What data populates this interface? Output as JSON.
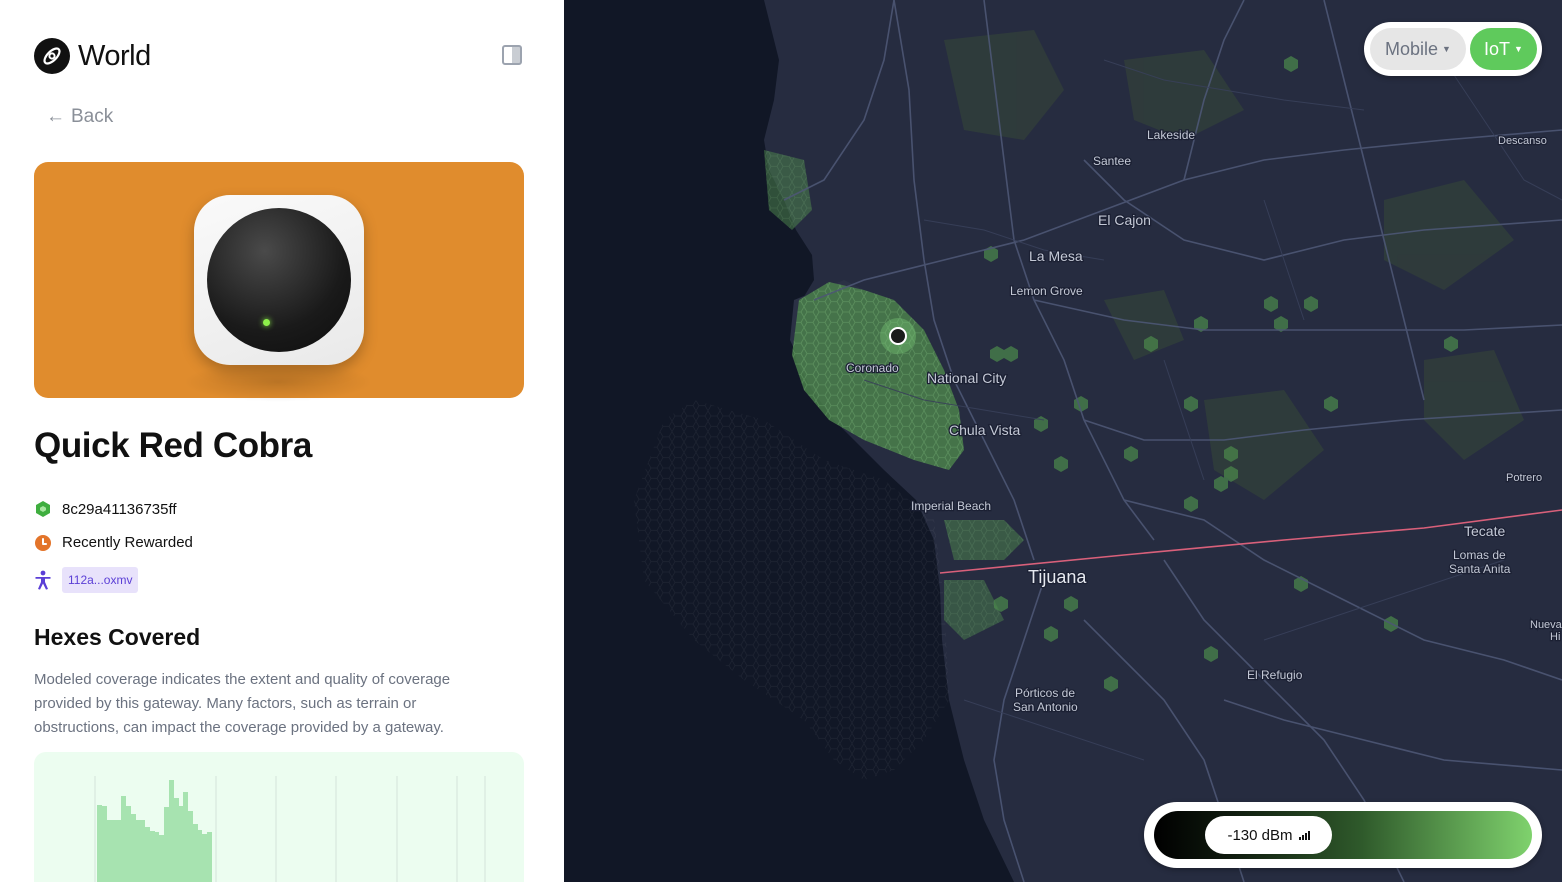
{
  "brand": {
    "name": "World",
    "logo_icon": "helium-logo-icon"
  },
  "nav": {
    "back_label": "Back"
  },
  "gateway": {
    "name": "Quick Red Cobra",
    "hex_id": "8c29a41136735ff",
    "reward_status": "Recently Rewarded",
    "owner": "112a...oxmv",
    "hero_color": "#e08c2d",
    "led_color": "#8df04a"
  },
  "coverage": {
    "title": "Hexes Covered",
    "description": "Modeled coverage indicates the extent and quality of coverage provided by this gateway. Many factors, such as terrain or obstructions, can impact the coverage provided by a gateway."
  },
  "network_switch": {
    "mobile_label": "Mobile",
    "iot_label": "IoT",
    "selected": "IoT",
    "iot_color": "#5fca5c"
  },
  "signal_legend": {
    "value_label": "-130 dBm"
  },
  "map": {
    "labels": {
      "lakeside": "Lakeside",
      "descanso": "Descanso",
      "santee": "Santee",
      "el_cajon": "El Cajon",
      "la_mesa": "La Mesa",
      "lemon_grove": "Lemon Grove",
      "coronado": "Coronado",
      "national_city": "National City",
      "chula_vista": "Chula Vista",
      "imperial_beach": "Imperial Beach",
      "tijuana": "Tijuana",
      "tecate": "Tecate",
      "potrero": "Potrero",
      "lomas_1": "Lomas de",
      "lomas_2": "Santa Anita",
      "nueva": "Nueva",
      "nueva_2": "Hi",
      "el_refugio": "El Refugio",
      "porticos_1": "Pórticos de",
      "porticos_2": "San Antonio"
    }
  }
}
